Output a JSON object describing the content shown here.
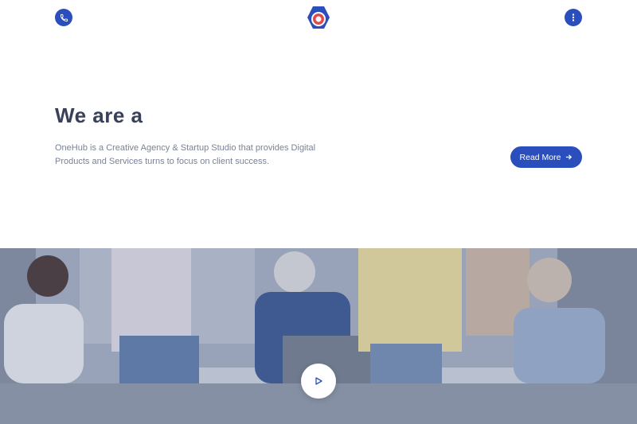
{
  "header": {
    "phone_icon": "phone-icon",
    "menu_icon": "vertical-dots-icon",
    "logo": "brand-logo"
  },
  "hero": {
    "headline": "We are a",
    "description": "OneHub is a Creative Agency & Startup Studio that provides Digital Products and Services turns to focus on client success.",
    "read_more_label": "Read More",
    "read_more_icon": "arrow-right-icon"
  },
  "media": {
    "play_icon": "play-icon"
  },
  "colors": {
    "accent": "#2a4fbd",
    "headline": "#39405a",
    "body_text": "#7a8296",
    "overlay": "#8690a4"
  }
}
